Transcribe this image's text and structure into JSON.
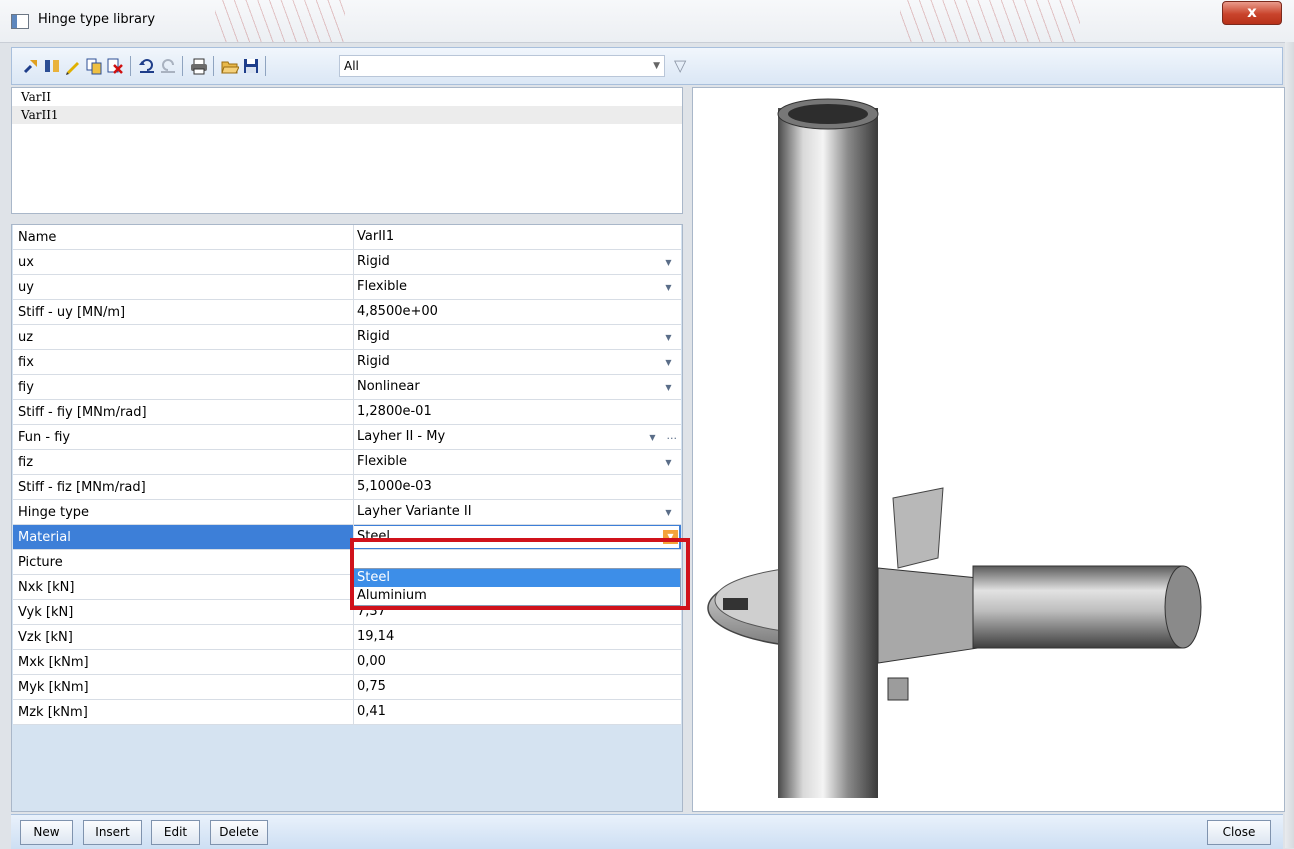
{
  "window": {
    "title": "Hinge type library",
    "close_glyph": "x"
  },
  "toolbar": {
    "icons": [
      "pin-icon",
      "split-icon",
      "edit-icon",
      "copy-icon",
      "delete-icon",
      "undo-icon",
      "redo-icon",
      "print-icon",
      "open-icon",
      "save-icon"
    ],
    "filter_value": "All",
    "filter_icon": "filter-icon"
  },
  "list": {
    "items": [
      {
        "label": "VarII",
        "selected": false
      },
      {
        "label": "VarII1",
        "selected": true
      }
    ]
  },
  "properties": [
    {
      "name": "Name",
      "value": "VarII1",
      "kind": "text"
    },
    {
      "name": "ux",
      "value": "Rigid",
      "kind": "dropdown"
    },
    {
      "name": "uy",
      "value": "Flexible",
      "kind": "dropdown"
    },
    {
      "name": "Stiff - uy [MN/m]",
      "value": "4,8500e+00",
      "kind": "text"
    },
    {
      "name": "uz",
      "value": "Rigid",
      "kind": "dropdown"
    },
    {
      "name": "fix",
      "value": "Rigid",
      "kind": "dropdown"
    },
    {
      "name": "fiy",
      "value": "Nonlinear",
      "kind": "dropdown"
    },
    {
      "name": "Stiff - fiy [MNm/rad]",
      "value": "1,2800e-01",
      "kind": "text"
    },
    {
      "name": "Fun -  fiy",
      "value": "Layher II - My",
      "kind": "dropdown-ellipsis"
    },
    {
      "name": "fiz",
      "value": "Flexible",
      "kind": "dropdown"
    },
    {
      "name": "Stiff - fiz [MNm/rad]",
      "value": "5,1000e-03",
      "kind": "text"
    },
    {
      "name": "Hinge type",
      "value": "Layher Variante II",
      "kind": "dropdown"
    },
    {
      "name": "Material",
      "value": "Steel",
      "kind": "selected"
    },
    {
      "name": "Picture",
      "value": "",
      "kind": "text"
    },
    {
      "name": "Nxk [kN]",
      "value": "",
      "kind": "text"
    },
    {
      "name": "Vyk [kN]",
      "value": "7,37",
      "kind": "text"
    },
    {
      "name": "Vzk [kN]",
      "value": "19,14",
      "kind": "text"
    },
    {
      "name": "Mxk [kNm]",
      "value": "0,00",
      "kind": "text"
    },
    {
      "name": "Myk [kNm]",
      "value": "0,75",
      "kind": "text"
    },
    {
      "name": "Mzk [kNm]",
      "value": "0,41",
      "kind": "text"
    }
  ],
  "material_dropdown": {
    "options": [
      "Steel",
      "Aluminium"
    ],
    "highlighted": "Steel"
  },
  "buttons": {
    "new": "New",
    "insert": "Insert",
    "edit": "Edit",
    "delete": "Delete",
    "close": "Close"
  },
  "colors": {
    "selection_blue": "#3d7fd8",
    "highlight_red": "#d0121b",
    "dropdown_orange": "#f4a43c"
  }
}
